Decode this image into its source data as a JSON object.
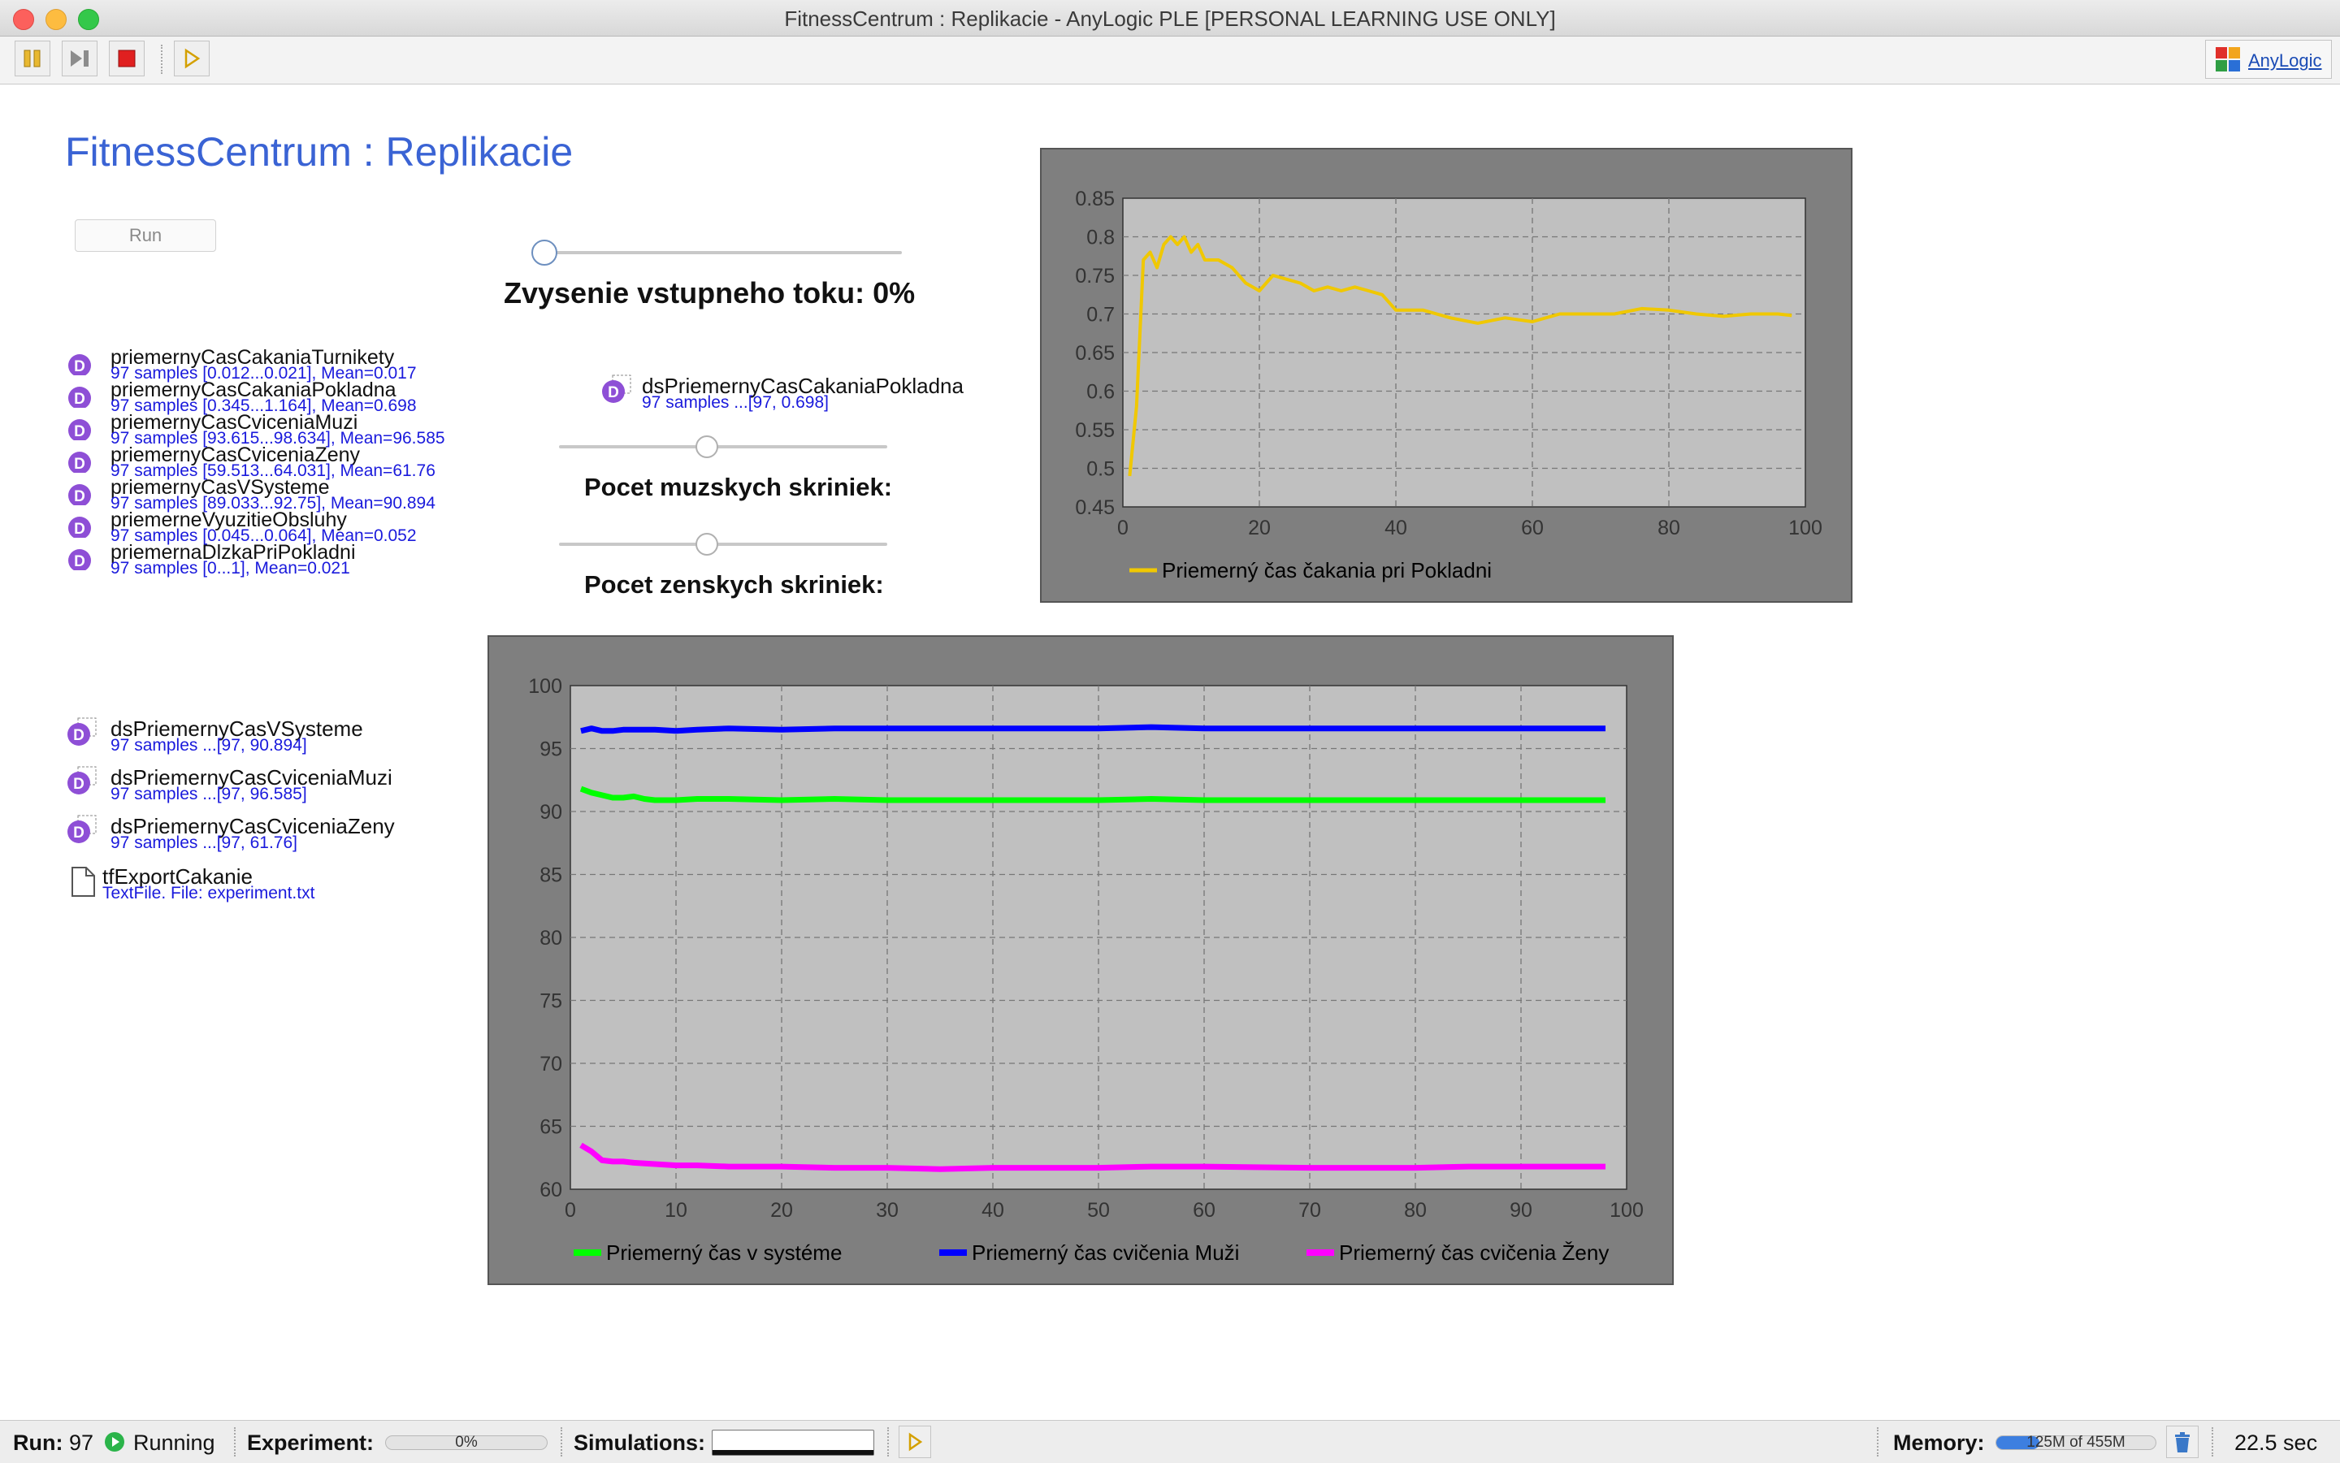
{
  "window": {
    "title": "FitnessCentrum : Replikacie - AnyLogic PLE [PERSONAL LEARNING USE ONLY]"
  },
  "toolbar": {
    "anylogic_label": "AnyLogic"
  },
  "page": {
    "title": "FitnessCentrum : Replikacie",
    "run_label": "Run"
  },
  "controls": {
    "flow_label": "Zvysenie vstupneho toku: 0%",
    "flow_value": 0,
    "male_lockers_label": "Pocet muzskych skriniek:",
    "male_lockers_position": 0.45,
    "female_lockers_label": "Pocet zenskych skriniek:",
    "female_lockers_position": 0.45
  },
  "stats": [
    {
      "name": "priemernyCasCakaniaTurnikety",
      "info": "97 samples [0.012...0.021], Mean=0.017"
    },
    {
      "name": "priemernyCasCakaniaPokladna",
      "info": "97 samples [0.345...1.164], Mean=0.698"
    },
    {
      "name": "priemernyCasCviceniaMuzi",
      "info": "97 samples [93.615...98.634], Mean=96.585"
    },
    {
      "name": "priemernyCasCviceniaZeny",
      "info": "97 samples [59.513...64.031], Mean=61.76"
    },
    {
      "name": "priemernyCasVSysteme",
      "info": "97 samples [89.033...92.75], Mean=90.894"
    },
    {
      "name": "priemerneVyuzitieObsluhy",
      "info": "97 samples [0.045...0.064], Mean=0.052"
    },
    {
      "name": "priemernaDlzkaPriPokladni",
      "info": "97 samples [0...1], Mean=0.021"
    }
  ],
  "datasets": {
    "pokladna": {
      "name": "dsPriemernyCasCakaniaPokladna",
      "info": "97 samples ...[97, 0.698]"
    },
    "system": {
      "name": "dsPriemernyCasVSysteme",
      "info": "97 samples ...[97, 90.894]"
    },
    "muzi": {
      "name": "dsPriemernyCasCviceniaMuzi",
      "info": "97 samples ...[97, 96.585]"
    },
    "zeny": {
      "name": "dsPriemernyCasCviceniaZeny",
      "info": "97 samples ...[97, 61.76]"
    }
  },
  "textfile": {
    "name": "tfExportCakanie",
    "info": "TextFile. File: experiment.txt"
  },
  "chart_data": [
    {
      "type": "line",
      "xlim": [
        0,
        100
      ],
      "ylim": [
        0.45,
        0.85
      ],
      "x_ticks": [
        "0",
        "20",
        "40",
        "60",
        "80",
        "100"
      ],
      "y_ticks": [
        "0.45",
        "0.5",
        "0.55",
        "0.6",
        "0.65",
        "0.7",
        "0.75",
        "0.8",
        "0.85"
      ],
      "grid": true,
      "legend_position": "bottom",
      "series": [
        {
          "name": "Priemerný čas čakania pri Pokladni",
          "color": "#f0c800",
          "x": [
            1,
            2,
            3,
            4,
            5,
            6,
            7,
            8,
            9,
            10,
            11,
            12,
            14,
            16,
            18,
            20,
            22,
            24,
            26,
            28,
            30,
            32,
            34,
            36,
            38,
            40,
            44,
            48,
            52,
            56,
            60,
            64,
            68,
            72,
            76,
            80,
            84,
            88,
            92,
            96,
            98
          ],
          "y": [
            0.49,
            0.58,
            0.77,
            0.78,
            0.76,
            0.79,
            0.8,
            0.79,
            0.8,
            0.78,
            0.79,
            0.77,
            0.77,
            0.76,
            0.74,
            0.73,
            0.75,
            0.745,
            0.74,
            0.73,
            0.735,
            0.73,
            0.735,
            0.73,
            0.725,
            0.705,
            0.705,
            0.695,
            0.688,
            0.695,
            0.69,
            0.7,
            0.7,
            0.7,
            0.707,
            0.705,
            0.7,
            0.697,
            0.7,
            0.7,
            0.698
          ]
        }
      ]
    },
    {
      "type": "line",
      "xlim": [
        0,
        100
      ],
      "ylim": [
        60,
        100
      ],
      "x_ticks": [
        "0",
        "10",
        "20",
        "30",
        "40",
        "50",
        "60",
        "70",
        "80",
        "90",
        "100"
      ],
      "y_ticks": [
        "60",
        "65",
        "70",
        "75",
        "80",
        "85",
        "90",
        "95",
        "100"
      ],
      "grid": true,
      "legend_position": "bottom",
      "series": [
        {
          "name": "Priemerný čas v systéme",
          "color": "#00ff00",
          "x": [
            1,
            2,
            3,
            4,
            5,
            6,
            7,
            8,
            10,
            12,
            15,
            20,
            25,
            30,
            35,
            40,
            50,
            55,
            60,
            70,
            80,
            85,
            90,
            98
          ],
          "y": [
            91.8,
            91.5,
            91.3,
            91.1,
            91.1,
            91.2,
            91.0,
            90.9,
            90.9,
            91.0,
            91.0,
            90.9,
            91.0,
            90.9,
            90.9,
            90.9,
            90.9,
            91.0,
            90.9,
            90.9,
            90.9,
            90.9,
            90.9,
            90.9
          ]
        },
        {
          "name": "Priemerný čas cvičenia Muži",
          "color": "#0000ff",
          "x": [
            1,
            2,
            3,
            4,
            5,
            8,
            10,
            12,
            15,
            20,
            25,
            30,
            35,
            40,
            50,
            55,
            60,
            70,
            80,
            85,
            90,
            98
          ],
          "y": [
            96.4,
            96.6,
            96.4,
            96.4,
            96.5,
            96.5,
            96.4,
            96.5,
            96.6,
            96.5,
            96.6,
            96.6,
            96.6,
            96.6,
            96.6,
            96.7,
            96.6,
            96.6,
            96.6,
            96.6,
            96.6,
            96.6
          ]
        },
        {
          "name": "Priemerný čas cvičenia Ženy",
          "color": "#ff00ff",
          "x": [
            1,
            2,
            3,
            4,
            5,
            6,
            8,
            10,
            12,
            15,
            20,
            25,
            30,
            35,
            40,
            50,
            55,
            60,
            70,
            80,
            85,
            90,
            98
          ],
          "y": [
            63.5,
            63.0,
            62.3,
            62.2,
            62.2,
            62.1,
            62.0,
            61.9,
            61.9,
            61.8,
            61.8,
            61.7,
            61.7,
            61.6,
            61.7,
            61.7,
            61.8,
            61.8,
            61.7,
            61.7,
            61.8,
            61.8,
            61.8
          ]
        }
      ]
    }
  ],
  "status": {
    "run_label": "Run:",
    "run_value": "97",
    "state": "Running",
    "experiment_label": "Experiment:",
    "experiment_progress": "0%",
    "experiment_fraction": 0,
    "simulations_label": "Simulations:",
    "simulations_fraction": 1,
    "memory_label": "Memory:",
    "memory_value": "125M of 455M",
    "memory_fraction": 0.27,
    "time": "22.5 sec"
  }
}
